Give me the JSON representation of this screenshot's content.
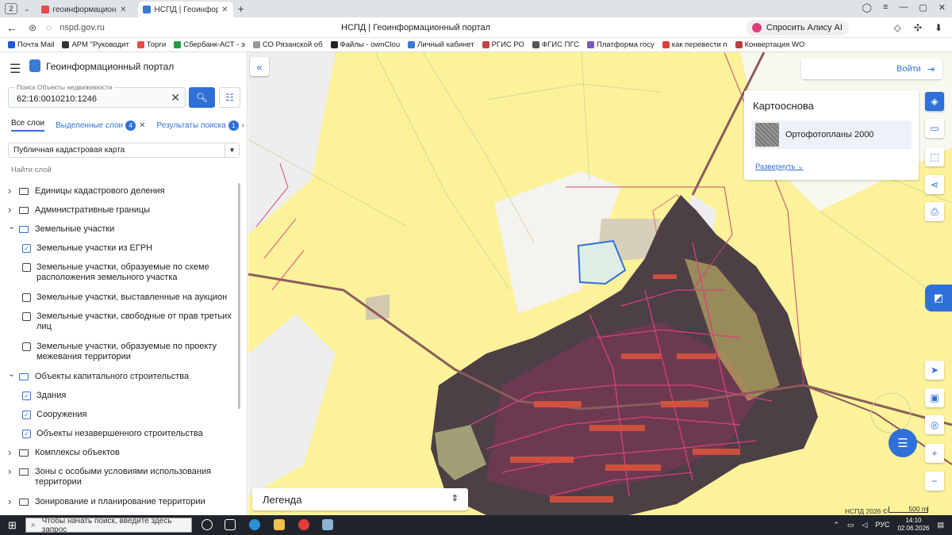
{
  "browser": {
    "tab_count": "2",
    "tabs": [
      {
        "title": "геоинформационный пор",
        "active": false
      },
      {
        "title": "НСПД | Геоинформаци",
        "active": true
      }
    ],
    "url": "nspd.gov.ru",
    "page_title": "НСПД | Геоинформационный портал",
    "alisa_label": "Спросить Алису AI",
    "bookmarks": [
      "Почта Mail",
      "АРМ \"Руководит",
      "Торги",
      "Сбербанк-АСТ - э",
      "СО Рязанской об",
      "Файлы - ownClou",
      "Личный кабинет",
      "РГИС РО",
      "ФГИС ПГС",
      "Платформа госу",
      "как перевести п",
      "Конвертация WO"
    ]
  },
  "app": {
    "title": "Геоинформационный портал",
    "search": {
      "placeholder": "Поиск Объекты недвижимости",
      "value": "62:16:0010210:1246"
    },
    "layer_tabs": {
      "all": "Все слои",
      "selected": "Выделенные слои",
      "selected_count": "4",
      "results": "Результаты поиска",
      "results_count": "1"
    },
    "map_select": "Публичная кадастровая карта",
    "find_layer": "Найти слой",
    "tree": [
      {
        "label": "Единицы кадастрового деления",
        "type": "folder",
        "expanded": false
      },
      {
        "label": "Административные границы",
        "type": "folder",
        "expanded": false
      },
      {
        "label": "Земельные участки",
        "type": "folder",
        "expanded": true
      },
      {
        "label": "Земельные участки из ЕГРН",
        "type": "check",
        "checked": true
      },
      {
        "label": "Земельные участки, образуемые по схеме",
        "label2": "расположения земельного участка",
        "type": "check",
        "checked": false
      },
      {
        "label": "Земельные участки, выставленные на аукцион",
        "type": "check",
        "checked": false
      },
      {
        "label": "Земельные участки, свободные от прав третьих",
        "label2": "лиц",
        "type": "check",
        "checked": false
      },
      {
        "label": "Земельные участки, образуемые по проекту",
        "label2": "межевания территории",
        "type": "check",
        "checked": false
      },
      {
        "label": "Объекты капитального строительства",
        "type": "folder",
        "expanded": true
      },
      {
        "label": "Здания",
        "type": "check",
        "checked": true
      },
      {
        "label": "Сооружения",
        "type": "check",
        "checked": true
      },
      {
        "label": "Объекты незавершенного строительства",
        "type": "check",
        "checked": true
      },
      {
        "label": "Комплексы объектов",
        "type": "folder",
        "expanded": false
      },
      {
        "label": "Зоны с особыми условиями использования",
        "label2": "территории",
        "type": "folder",
        "expanded": false
      },
      {
        "label": "Зонирование и планирование территории",
        "type": "folder",
        "expanded": false
      }
    ],
    "login": "Войти",
    "basemap": {
      "title": "Картооснова",
      "item": "Ортофотопланы 2000",
      "expand": "Развернуть"
    },
    "legend": "Легенда",
    "copyright": "НСПД 2026 ©",
    "scale": "500 m"
  },
  "taskbar": {
    "search_placeholder": "Чтобы начать поиск, введите здесь запрос",
    "lang": "РУС",
    "time": "14:10",
    "date": "02.06.2026"
  }
}
